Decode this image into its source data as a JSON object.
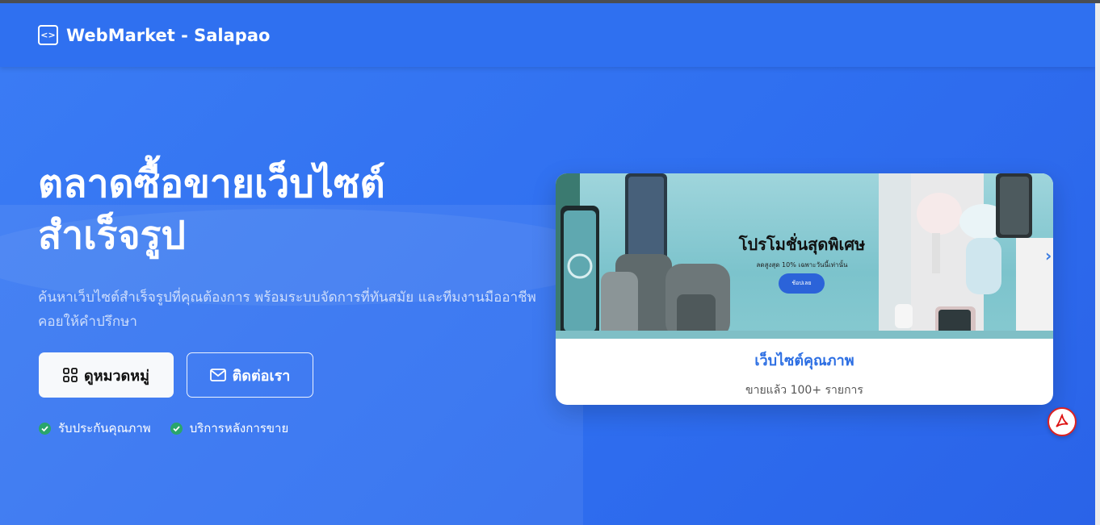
{
  "navbar": {
    "brand": "WebMarket - Salapao"
  },
  "hero": {
    "title_line1": "ตลาดซื้อขายเว็บไซต์",
    "title_line2": "สำเร็จรูป",
    "subtitle": "ค้นหาเว็บไซต์สำเร็จรูปที่คุณต้องการ พร้อมระบบจัดการที่ทันสมัย และทีมงานมืออาชีพคอยให้คำปรึกษา",
    "primary_button": "ดูหมวดหมู่",
    "outline_button": "ติดต่อเรา",
    "features": [
      "รับประกันคุณภาพ",
      "บริการหลังการขาย"
    ]
  },
  "card": {
    "banner": {
      "title": "โปรโมชั่นสุดพิเศษ",
      "subtitle": "ลดสูงสุด 10% เฉพาะวันนี้เท่านั้น",
      "button": "ช้อปเลย"
    },
    "title": "เว็บไซต์คุณภาพ",
    "caption": "ขายแล้ว 100+ รายการ"
  },
  "colors": {
    "primary": "#2f6ff0",
    "accent_text": "#2d6fe3",
    "check": "#2aa56b"
  }
}
